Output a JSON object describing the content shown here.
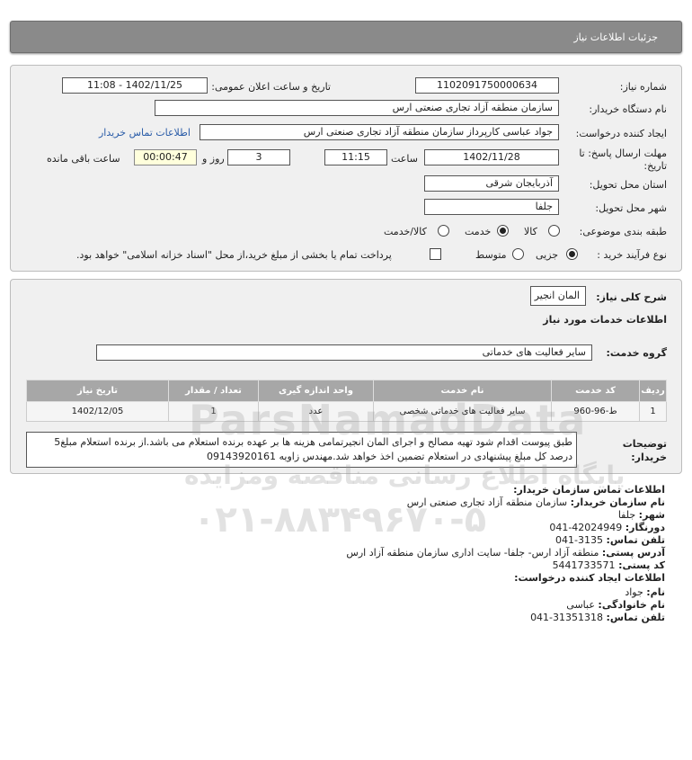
{
  "header": {
    "title": "جزئیات اطلاعات نیاز"
  },
  "form": {
    "need_number_label": "شماره نیاز:",
    "need_number": "1102091750000634",
    "announce_label": "تاریخ و ساعت اعلان عمومی:",
    "announce_value": "1402/11/25 - 11:08",
    "buyer_org_label": "نام دستگاه خریدار:",
    "buyer_org": "سازمان منطقه آزاد تجاری صنعتی ارس",
    "requester_label": "ایجاد کننده درخواست:",
    "requester": "جواد عباسی کارپرداز سازمان منطقه آزاد تجاری صنعتی ارس",
    "buyer_contact_link": "اطلاعات تماس خریدار",
    "deadline_label_1": "مهلت ارسال پاسخ: تا",
    "deadline_label_2": "تاریخ:",
    "deadline_date": "1402/11/28",
    "time_label": "ساعت",
    "deadline_time": "11:15",
    "days_value": "3",
    "days_label": "روز و",
    "remaining_value": "00:00:47",
    "remaining_label": "ساعت باقی مانده",
    "province_label": "استان محل تحویل:",
    "province": "آذربایجان شرقی",
    "city_label": "شهر محل تحویل:",
    "city": "جلفا",
    "category_label": "طبقه بندی موضوعی:",
    "category_options": [
      "کالا",
      "خدمت",
      "کالا/خدمت"
    ],
    "category_selected": "خدمت",
    "process_label": "نوع فرآیند خرید :",
    "process_options": [
      "جزیی",
      "متوسط"
    ],
    "process_selected": "جزیی",
    "payment_note": "پرداخت تمام یا بخشی از مبلغ خرید،از محل \"اسناد خزانه اسلامی\" خواهد بود."
  },
  "need": {
    "summary_label": "شرح کلی نیاز:",
    "summary_value": "المان انجیر",
    "services_heading": "اطلاعات خدمات مورد نیاز",
    "service_group_label": "گروه خدمت:",
    "service_group": "سایر فعالیت های خدماتی",
    "table": {
      "headers": [
        "ردیف",
        "کد خدمت",
        "نام خدمت",
        "واحد اندازه گیری",
        "تعداد / مقدار",
        "تاریخ نیاز"
      ],
      "rows": [
        [
          "1",
          "ط-96-960",
          "سایر فعالیت های خدماتی شخصی",
          "عدد",
          "1",
          "1402/12/05"
        ]
      ]
    },
    "notes_label": "توضیحات خریدار:",
    "notes": "طبق پیوست اقدام شود تهیه مصالح و اجرای المان انجیرتمامی هزینه ها بر عهده برنده استعلام می باشد.از برنده استعلام مبلغ5 درصد کل مبلغ پیشنهادی در استعلام تضمین اخذ خواهد شد.مهندس زاویه 09143920161"
  },
  "contact": {
    "buyer_heading": "اطلاعات تماس سازمان خریدار:",
    "org_label": "نام سازمان خریدار:",
    "org": "سازمان منطقه آزاد تجاری صنعتی ارس",
    "city_label": "شهر:",
    "city": "جلفا",
    "fax_label": "دورنگار:",
    "fax": "041-42024949",
    "phone_label": "تلفن تماس:",
    "phone": "041-3135",
    "address_label": "آدرس پستی:",
    "address": "منطقه آزاد ارس- جلفا- سایت اداری سازمان منطقه آزاد ارس",
    "postal_label": "کد پستی:",
    "postal": "5441733571",
    "creator_heading": "اطلاعات ایجاد کننده درخواست:",
    "first_name_label": "نام:",
    "first_name": "جواد",
    "last_name_label": "نام خانوادگی:",
    "last_name": "عباسی",
    "creator_phone_label": "تلفن تماس:",
    "creator_phone": "041-31351318"
  },
  "watermark": {
    "line1": "پایگاه اطلاع رسانی مناقصه ومزایده",
    "line2": "۰۲۱-۸۸۳۴۹۶۷۰-۵",
    "brand": "ParsNamadData"
  }
}
